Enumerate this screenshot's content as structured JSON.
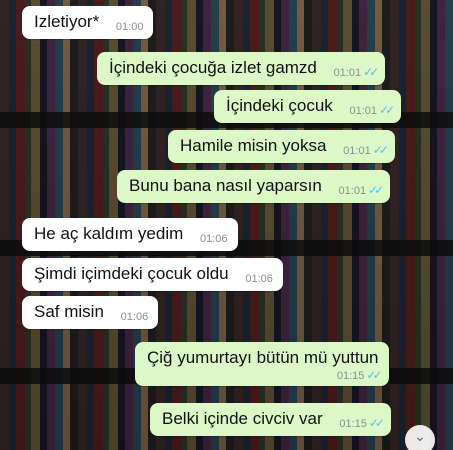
{
  "messages": [
    {
      "text": "Izletiyor*",
      "time": "01:00"
    },
    {
      "text": "İçindeki çocuğa izlet gamzd",
      "time": "01:01"
    },
    {
      "text": "İçindeki çocuk",
      "time": "01:01"
    },
    {
      "text": "Hamile misin yoksa",
      "time": "01:01"
    },
    {
      "text": "Bunu bana nasıl yaparsın",
      "time": "01:01"
    },
    {
      "text": "He aç kaldım yedim",
      "time": "01:06"
    },
    {
      "text": "Şimdi içimdeki çocuk oldu",
      "time": "01:06"
    },
    {
      "text": "Saf misin",
      "time": "01:06"
    },
    {
      "text": "Çiğ yumurtayı bütün mü yuttun",
      "time": "01:15"
    },
    {
      "text": "Belki içinde civciv var",
      "time": "01:15"
    }
  ],
  "icons": {
    "read_receipt": "double-check-icon",
    "scroll_down": "chevron-down-icon"
  },
  "colors": {
    "incoming_bubble": "#ffffff",
    "outgoing_bubble": "#dcf8c6",
    "read_tick": "#4fc3f7"
  }
}
